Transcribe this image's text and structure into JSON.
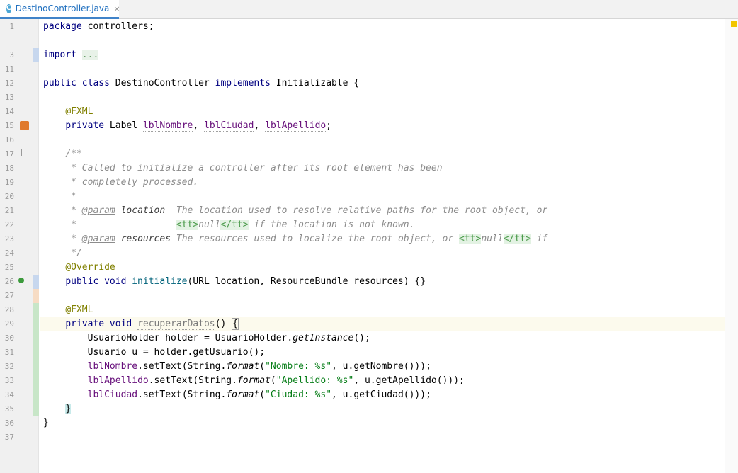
{
  "tab": {
    "icon": "C",
    "label": "DestinoController.java",
    "close": "×"
  },
  "lines": [
    {
      "n": "1"
    },
    {
      "n": "3"
    },
    {
      "n": "11"
    },
    {
      "n": "12"
    },
    {
      "n": "13"
    },
    {
      "n": "14"
    },
    {
      "n": "15"
    },
    {
      "n": "16"
    },
    {
      "n": "17"
    },
    {
      "n": "18"
    },
    {
      "n": "19"
    },
    {
      "n": "20"
    },
    {
      "n": "21"
    },
    {
      "n": "22"
    },
    {
      "n": "23"
    },
    {
      "n": "24"
    },
    {
      "n": "25"
    },
    {
      "n": "26"
    },
    {
      "n": "27"
    },
    {
      "n": "28"
    },
    {
      "n": "29"
    },
    {
      "n": "30"
    },
    {
      "n": "31"
    },
    {
      "n": "32"
    },
    {
      "n": "33"
    },
    {
      "n": "34"
    },
    {
      "n": "35"
    },
    {
      "n": "36"
    },
    {
      "n": "37"
    }
  ],
  "code": {
    "l1": {
      "kw": "package",
      "rest": " controllers;"
    },
    "l3": {
      "kw": "import",
      "fold": "..."
    },
    "l12": {
      "kw": "public class",
      "name": " DestinoController ",
      "impl": "implements",
      "rest": " Initializable {"
    },
    "l14": {
      "ann": "@FXML"
    },
    "l15": {
      "kw": "private",
      "type": " Label ",
      "f1": "lblNombre",
      "s1": ", ",
      "f2": "lblCiudad",
      "s2": ", ",
      "f3": "lblApellido",
      "end": ";"
    },
    "l17": {
      "doc": "/**"
    },
    "l18": {
      "doc": " * Called to initialize a controller after its root element has been"
    },
    "l19": {
      "doc": " * completely processed."
    },
    "l20": {
      "doc": " *"
    },
    "l21": {
      "star": " * ",
      "tag": "@param",
      "param": " location",
      "doc": "  The location used to resolve relative paths for the root object, or"
    },
    "l22": {
      "star": " *                  ",
      "tt1": "<tt>",
      "nul": "null",
      "tt2": "</tt>",
      "doc": " if the location is not known."
    },
    "l23": {
      "star": " * ",
      "tag": "@param",
      "param": " resources",
      "doc": " The resources used to localize the root object, or ",
      "tt1": "<tt>",
      "nul": "null",
      "tt2": "</tt>",
      "doc2": " if"
    },
    "l24": {
      "doc": " */"
    },
    "l25": {
      "ann": "@Override"
    },
    "l26": {
      "kw": "public void",
      "m": " initialize",
      "rest": "(URL location, ResourceBundle resources) {}"
    },
    "l28": {
      "ann": "@FXML"
    },
    "l29": {
      "kw": "private void",
      "m": "recuperarDatos",
      "rest": "() ",
      "brace": "{"
    },
    "l30": {
      "a": "UsuarioHolder holder = UsuarioHolder.",
      "i": "getInstance",
      "b": "();"
    },
    "l31": {
      "a": "Usuario u = holder.getUsuario();"
    },
    "l32": {
      "f": "lblNombre",
      "a": ".setText(String.",
      "i": "format",
      "b": "(",
      "s": "\"Nombre: %s\"",
      "c": ", u.getNombre()));"
    },
    "l33": {
      "f": "lblApellido",
      "a": ".setText(String.",
      "i": "format",
      "b": "(",
      "s": "\"Apellido: %s\"",
      "c": ", u.getApellido()));"
    },
    "l34": {
      "f": "lblCiudad",
      "a": ".setText(String.",
      "i": "format",
      "b": "(",
      "s": "\"Ciudad: %s\"",
      "c": ", u.getCiudad()));"
    },
    "l35": {
      "brace": "}"
    },
    "l36": {
      "brace": "}"
    }
  }
}
